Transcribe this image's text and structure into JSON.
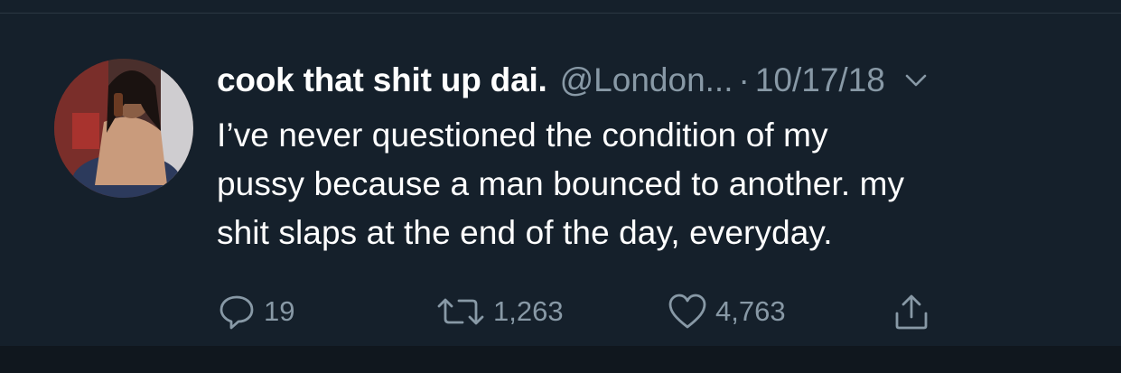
{
  "tweet": {
    "display_name": "cook that shit up dai.",
    "handle": "@London...",
    "separator": "·",
    "date": "10/17/18",
    "lines": [
      "I’ve never questioned the condition of my",
      "pussy because a man bounced to another. my",
      "shit slaps at the end of the day, everyday."
    ],
    "actions": {
      "reply": {
        "icon": "reply-icon",
        "count": "19"
      },
      "retweet": {
        "icon": "retweet-icon",
        "count": "1,263"
      },
      "like": {
        "icon": "heart-icon",
        "count": "4,763"
      },
      "share": {
        "icon": "share-icon"
      }
    }
  },
  "colors": {
    "background": "#15202b",
    "text": "#ffffff",
    "secondary": "#8899a6",
    "bottom_band": "#10171e"
  }
}
